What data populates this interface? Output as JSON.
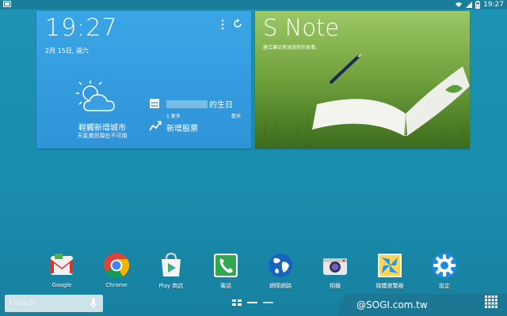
{
  "status_bar": {
    "time": "19:27"
  },
  "clock_widget": {
    "time": "19:27",
    "date": "2月 15日, 週六",
    "weather": {
      "city": "輕觸新增城市",
      "status": "天氣資訊現在不可用"
    },
    "calendar": {
      "title": "的生日",
      "more": "1 更多",
      "when": "整天"
    },
    "stocks": {
      "label": "新增股票"
    }
  },
  "snote_widget": {
    "title": "S Note",
    "subtitle": "建立筆記來述說你的故事。"
  },
  "dock": {
    "apps": [
      {
        "label": "Google",
        "icon": "gmail-icon"
      },
      {
        "label": "Chrome",
        "icon": "chrome-icon"
      },
      {
        "label": "Play 商店",
        "icon": "play-store-icon"
      },
      {
        "label": "電話",
        "icon": "phone-icon"
      },
      {
        "label": "網際網路",
        "icon": "internet-globe-icon"
      },
      {
        "label": "相機",
        "icon": "camera-icon"
      },
      {
        "label": "媒體瀏覽器",
        "icon": "gallery-icon"
      },
      {
        "label": "設定",
        "icon": "settings-gear-icon"
      }
    ]
  },
  "google_search": {
    "logo": "Google"
  },
  "watermark": "@SOGI.com.tw",
  "colors": {
    "background": "#1a8dae",
    "clock_widget": "#3399dd",
    "accent_white": "#ffffff"
  }
}
